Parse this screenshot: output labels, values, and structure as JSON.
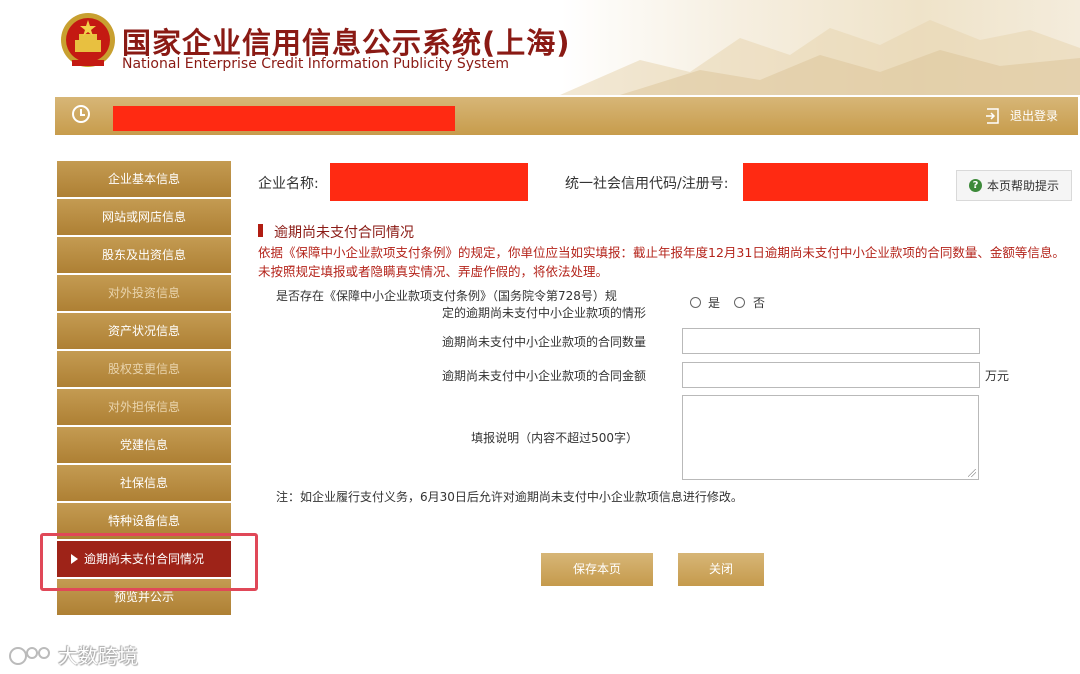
{
  "header": {
    "title_cn": "国家企业信用信息公示系统(上海)",
    "title_en": "National Enterprise Credit Information Publicity System"
  },
  "topbar": {
    "logout_label": "退出登录"
  },
  "sidebar": {
    "items": [
      {
        "label": "企业基本信息",
        "state": "normal"
      },
      {
        "label": "网站或网店信息",
        "state": "normal"
      },
      {
        "label": "股东及出资信息",
        "state": "normal"
      },
      {
        "label": "对外投资信息",
        "state": "dim"
      },
      {
        "label": "资产状况信息",
        "state": "normal"
      },
      {
        "label": "股权变更信息",
        "state": "dim"
      },
      {
        "label": "对外担保信息",
        "state": "dim"
      },
      {
        "label": "党建信息",
        "state": "normal"
      },
      {
        "label": "社保信息",
        "state": "normal"
      },
      {
        "label": "特种设备信息",
        "state": "normal"
      },
      {
        "label": "逾期尚未支付合同情况",
        "state": "active"
      },
      {
        "label": "预览并公示",
        "state": "normal"
      }
    ]
  },
  "main": {
    "company_name_label": "企业名称:",
    "credit_code_label": "统一社会信用代码/注册号:",
    "help_label": "本页帮助提示",
    "section_title": "逾期尚未支付合同情况",
    "notice": "依据《保障中小企业款项支付条例》的规定，你单位应当如实填报：截止年报年度12月31日逾期尚未支付中小企业款项的合同数量、金额等信息。未按照规定填报或者隐瞒真实情况、弄虚作假的，将依法处理。",
    "question_line1": "是否存在《保障中小企业款项支付条例》（国务院令第728号）规",
    "question_line2": "定的逾期尚未支付中小企业款项的情形",
    "radio_yes": "是",
    "radio_no": "否",
    "count_label": "逾期尚未支付中小企业款项的合同数量",
    "amount_label": "逾期尚未支付中小企业款项的合同金额",
    "amount_unit": "万元",
    "desc_label": "填报说明（内容不超过500字）",
    "footnote": "注：如企业履行支付义务，6月30日后允许对逾期尚未支付中小企业款项信息进行修改。",
    "save_label": "保存本页",
    "close_label": "关闭"
  },
  "watermark": {
    "text": "大数跨境"
  },
  "colors": {
    "brand_red": "#8a1a14",
    "gold": "#c59a4c",
    "active_red": "#9e2318",
    "notice_red": "#b4241b",
    "redaction": "#ff2a12"
  }
}
